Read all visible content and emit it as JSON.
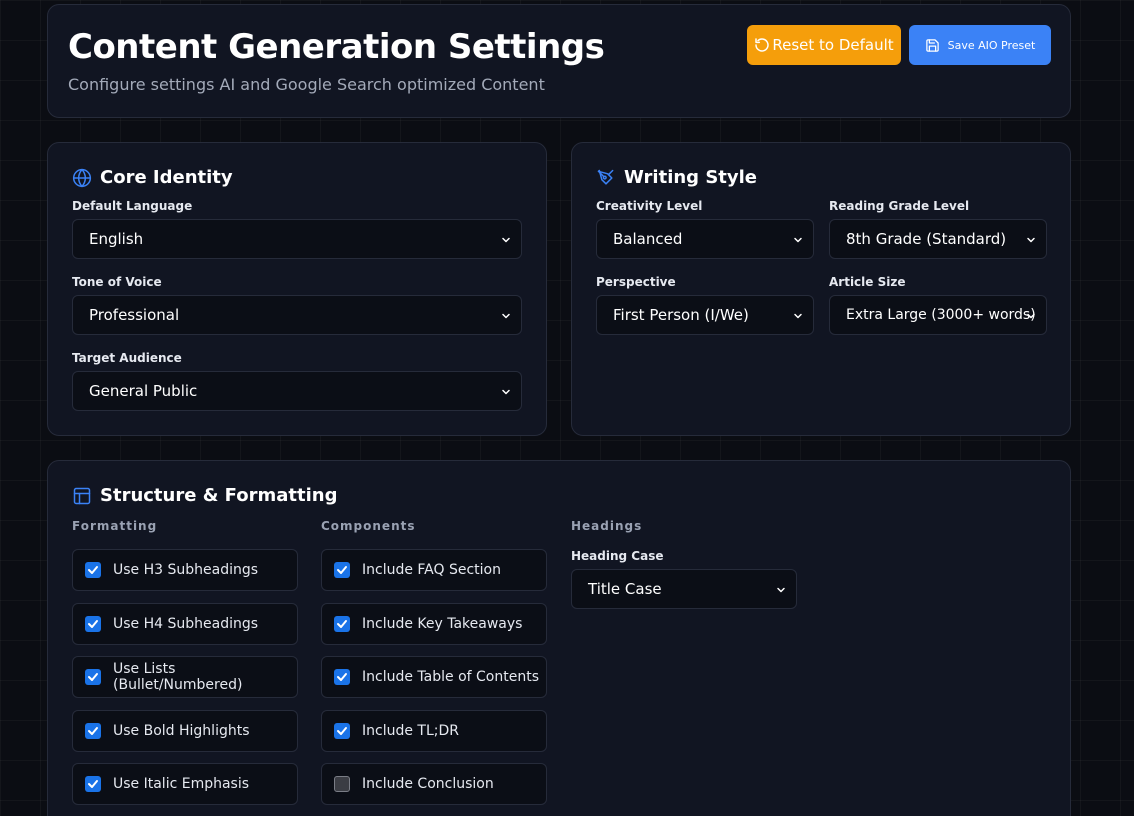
{
  "header": {
    "title": "Content Generation Settings",
    "subtitle": "Configure settings AI and Google Search optimized Content",
    "reset_label": "Reset to Default",
    "save_label": "Save AIO Preset"
  },
  "core_identity": {
    "title": "Core Identity",
    "fields": [
      {
        "label": "Default Language",
        "value": "English"
      },
      {
        "label": "Tone of Voice",
        "value": "Professional"
      },
      {
        "label": "Target Audience",
        "value": "General Public"
      }
    ]
  },
  "writing_style": {
    "title": "Writing Style",
    "fields": [
      {
        "label": "Creativity Level",
        "value": "Balanced"
      },
      {
        "label": "Reading Grade Level",
        "value": "8th Grade (Standard)"
      },
      {
        "label": "Perspective",
        "value": "First Person (I/We)"
      },
      {
        "label": "Article Size",
        "value": "Extra Large (3000+ words)"
      }
    ]
  },
  "structure": {
    "title": "Structure & Formatting",
    "formatting": {
      "heading": "Formatting",
      "items": [
        {
          "label": "Use H3 Subheadings",
          "checked": true
        },
        {
          "label": "Use H4 Subheadings",
          "checked": true
        },
        {
          "label": "Use Lists (Bullet/Numbered)",
          "checked": true
        },
        {
          "label": "Use Bold Highlights",
          "checked": true
        },
        {
          "label": "Use Italic Emphasis",
          "checked": true
        }
      ]
    },
    "components": {
      "heading": "Components",
      "items": [
        {
          "label": "Include FAQ Section",
          "checked": true
        },
        {
          "label": "Include Key Takeaways",
          "checked": true
        },
        {
          "label": "Include Table of Contents",
          "checked": true
        },
        {
          "label": "Include TL;DR",
          "checked": true
        },
        {
          "label": "Include Conclusion",
          "checked": false
        }
      ]
    },
    "headings": {
      "heading": "Headings",
      "case_label": "Heading Case",
      "case_value": "Title Case"
    }
  },
  "colors": {
    "accent_blue": "#3b82f6",
    "reset_orange": "#f59e0b",
    "checkbox_blue": "#1a73e8",
    "card_bg": "#111522",
    "page_bg": "#0b0d13"
  },
  "icons": {
    "core": "globe-icon",
    "style": "pen-nib-icon",
    "structure": "layout-icon",
    "reset": "rotate-ccw-icon",
    "save": "floppy-disk-icon",
    "select": "chevron-down-icon"
  }
}
